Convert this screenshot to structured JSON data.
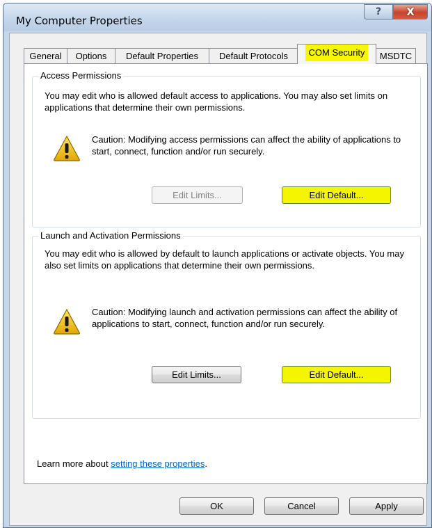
{
  "window": {
    "title": "My Computer Properties",
    "help_glyph": "?",
    "close_glyph": "X"
  },
  "tabs": [
    {
      "label": "General"
    },
    {
      "label": "Options"
    },
    {
      "label": "Default Properties"
    },
    {
      "label": "Default Protocols"
    },
    {
      "label": "COM Security",
      "selected": true
    },
    {
      "label": "MSDTC"
    }
  ],
  "access": {
    "title": "Access Permissions",
    "description": "You may edit who is allowed default access to applications. You may also set limits on applications that determine their own permissions.",
    "caution": "Caution: Modifying access permissions can affect the ability of applications to start, connect, function and/or run securely.",
    "edit_limits": "Edit Limits...",
    "edit_default": "Edit Default..."
  },
  "launch": {
    "title": "Launch and Activation Permissions",
    "description": "You may edit who is allowed by default to launch applications or activate objects. You may also set limits on applications that determine their own permissions.",
    "caution": "Caution: Modifying launch and activation permissions can affect the ability of applications to start, connect, function and/or run securely.",
    "edit_limits": "Edit Limits...",
    "edit_default": "Edit Default..."
  },
  "learn_more": {
    "prefix": "Learn more about ",
    "link": "setting these properties",
    "suffix": "."
  },
  "footer": {
    "ok": "OK",
    "cancel": "Cancel",
    "apply": "Apply"
  },
  "colors": {
    "highlight": "#f5f500",
    "link": "#0066cc",
    "window_frame": "#c6d7ea"
  },
  "icons": {
    "caution": "warning-triangle-icon"
  }
}
